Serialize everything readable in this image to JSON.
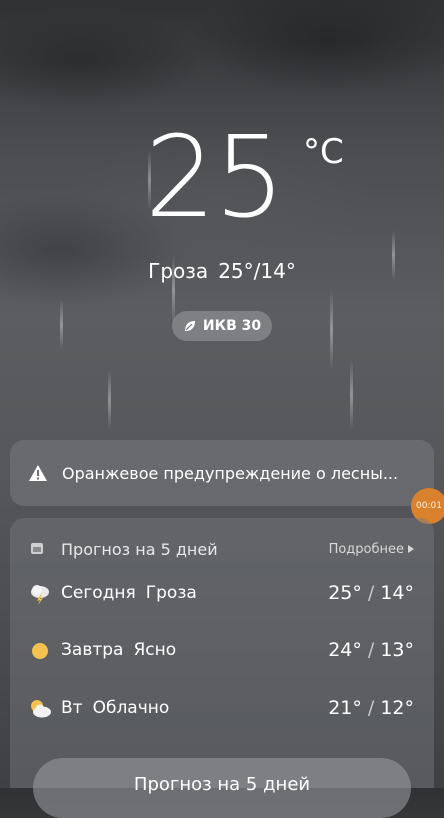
{
  "current": {
    "temperature": "25",
    "unit": "°C",
    "condition": "Гроза",
    "range": "25°/14°",
    "aqi_label": "ИКВ 30"
  },
  "alert": {
    "text": "Оранжевое предупреждение о лесны..."
  },
  "recording_timer": "00:01",
  "forecast": {
    "title": "Прогноз на 5 дней",
    "more_label": "Подробнее",
    "days": [
      {
        "day": "Сегодня",
        "condition": "Гроза",
        "high": "25°",
        "low": "14°",
        "icon": "thunderstorm-icon"
      },
      {
        "day": "Завтра",
        "condition": "Ясно",
        "high": "24°",
        "low": "13°",
        "icon": "sun-icon"
      },
      {
        "day": "Вт",
        "condition": "Облачно",
        "high": "21°",
        "low": "12°",
        "icon": "partly-cloudy-icon"
      }
    ],
    "separator": "/",
    "button_label": "Прогноз на 5 дней"
  },
  "colors": {
    "accent_orange": "#d9812c",
    "sun": "#f3c24f"
  }
}
